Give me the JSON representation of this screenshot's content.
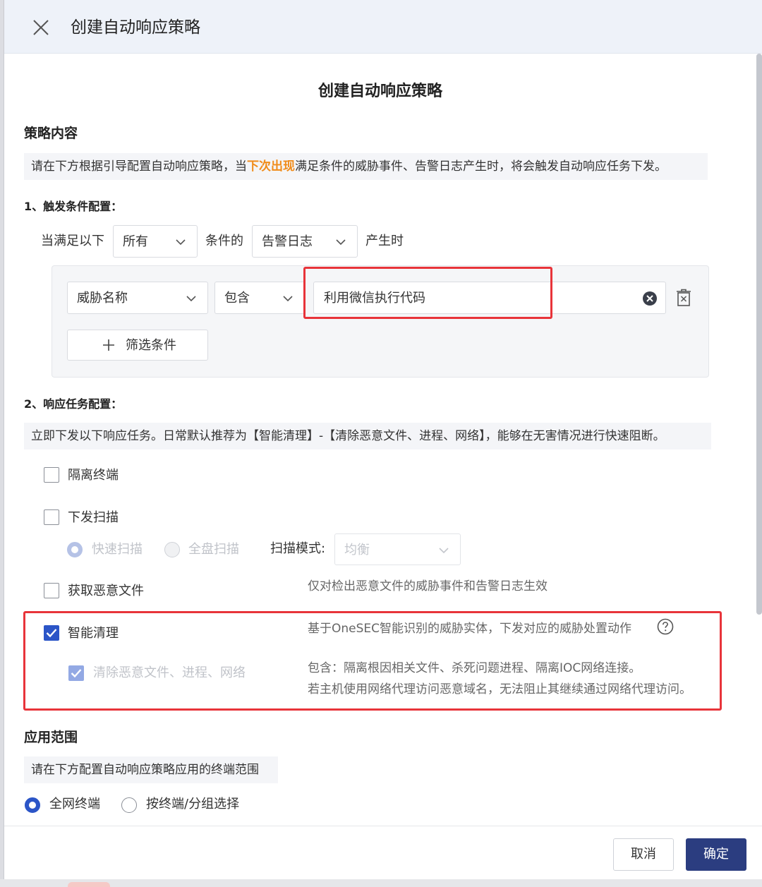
{
  "header": {
    "title": "创建自动响应策略"
  },
  "page_title": "创建自动响应策略",
  "strategy_section": {
    "title": "策略内容",
    "info_prefix": "请在下方根据引导配置自动响应策略，当",
    "info_highlight": "下次出现",
    "info_suffix": "满足条件的威胁事件、告警日志产生时，将会触发自动响应任务下发。"
  },
  "trigger": {
    "title": "1、触发条件配置：",
    "prefix": "当满足以下",
    "match_select": "所有",
    "middle": "条件的",
    "type_select": "告警日志",
    "suffix": "产生时",
    "condition": {
      "field_select": "威胁名称",
      "operator_select": "包含",
      "value": "利用微信执行代码"
    },
    "add_filter_label": "筛选条件"
  },
  "response": {
    "title": "2、响应任务配置：",
    "info": "立即下发以下响应任务。日常默认推荐为【智能清理】-【清除恶意文件、进程、网络】，能够在无害情况进行快速阻断。",
    "isolate_label": "隔离终端",
    "scan_label": "下发扫描",
    "quick_scan_label": "快速扫描",
    "full_scan_label": "全盘扫描",
    "scan_mode_label": "扫描模式:",
    "scan_mode_value": "均衡",
    "fetch_label": "获取恶意文件",
    "fetch_desc": "仅对检出恶意文件的威胁事件和告警日志生效",
    "smart_label": "智能清理",
    "smart_desc": "基于OneSEC智能识别的威胁实体，下发对应的威胁处置动作",
    "clean_label": "清除恶意文件、进程、网络",
    "clean_desc_1": "包含：隔离根因相关文件、杀死问题进程、隔离IOC网络连接。",
    "clean_desc_2": "若主机使用网络代理访问恶意域名，无法阻止其继续通过网络代理访问。"
  },
  "scope": {
    "title": "应用范围",
    "info": "请在下方配置自动响应策略应用的终端范围",
    "all_label": "全网终端",
    "group_label": "按终端/分组选择"
  },
  "footer": {
    "cancel_label": "取消",
    "ok_label": "确定"
  },
  "colors": {
    "primary": "#2b55c7",
    "confirm": "#2b3d80",
    "highlight": "#f08c1b",
    "annotation": "#e8343a"
  }
}
